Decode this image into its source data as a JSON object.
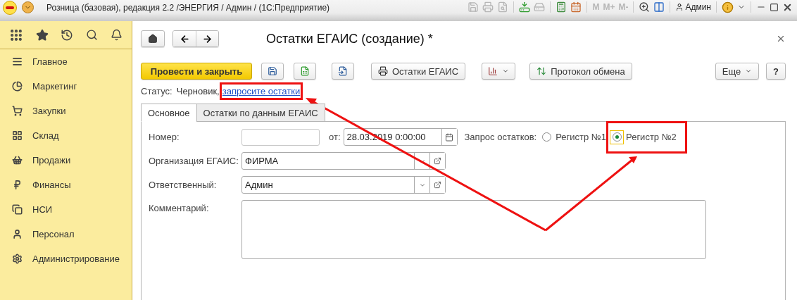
{
  "title_bar": {
    "title": "Розница (базовая), редакция 2.2 /ЭНЕРГИЯ / Админ /  (1С:Предприятие)",
    "memory_keys": [
      "M",
      "M+",
      "M-"
    ],
    "user": "Админ"
  },
  "sidebar": {
    "items": [
      {
        "label": "Главное"
      },
      {
        "label": "Маркетинг"
      },
      {
        "label": "Закупки"
      },
      {
        "label": "Склад"
      },
      {
        "label": "Продажи"
      },
      {
        "label": "Финансы"
      },
      {
        "label": "НСИ"
      },
      {
        "label": "Персонал"
      },
      {
        "label": "Администрирование"
      }
    ]
  },
  "form": {
    "title": "Остатки ЕГАИС (создание) *",
    "command_bar": {
      "primary": "Провести и закрыть",
      "print_button": "Остатки ЕГАИС",
      "exchange_button": "Протокол обмена",
      "more_button": "Еще",
      "help_button": "?"
    },
    "status": {
      "label": "Статус:",
      "value": "Черновик,",
      "link": "запросите остатки",
      "highlighted": true
    },
    "tabs": [
      {
        "label": "Основное",
        "selected": true
      },
      {
        "label": "Остатки по данным ЕГАИС",
        "selected": false
      }
    ],
    "number": {
      "label": "Номер:",
      "date_label": "от:",
      "date": "28.03.2019  0:00:00"
    },
    "request": {
      "label": "Запрос остатков:",
      "options": [
        {
          "label": "Регистр №1",
          "selected": false,
          "focused": false,
          "highlighted": false
        },
        {
          "label": "Регистр №2",
          "selected": true,
          "focused": true,
          "highlighted": true
        }
      ]
    },
    "organization": {
      "label": "Организация ЕГАИС:",
      "value": "ФИРМА"
    },
    "responsible": {
      "label": "Ответственный:",
      "value": "Админ"
    },
    "comment": {
      "label": "Комментарий:"
    }
  }
}
